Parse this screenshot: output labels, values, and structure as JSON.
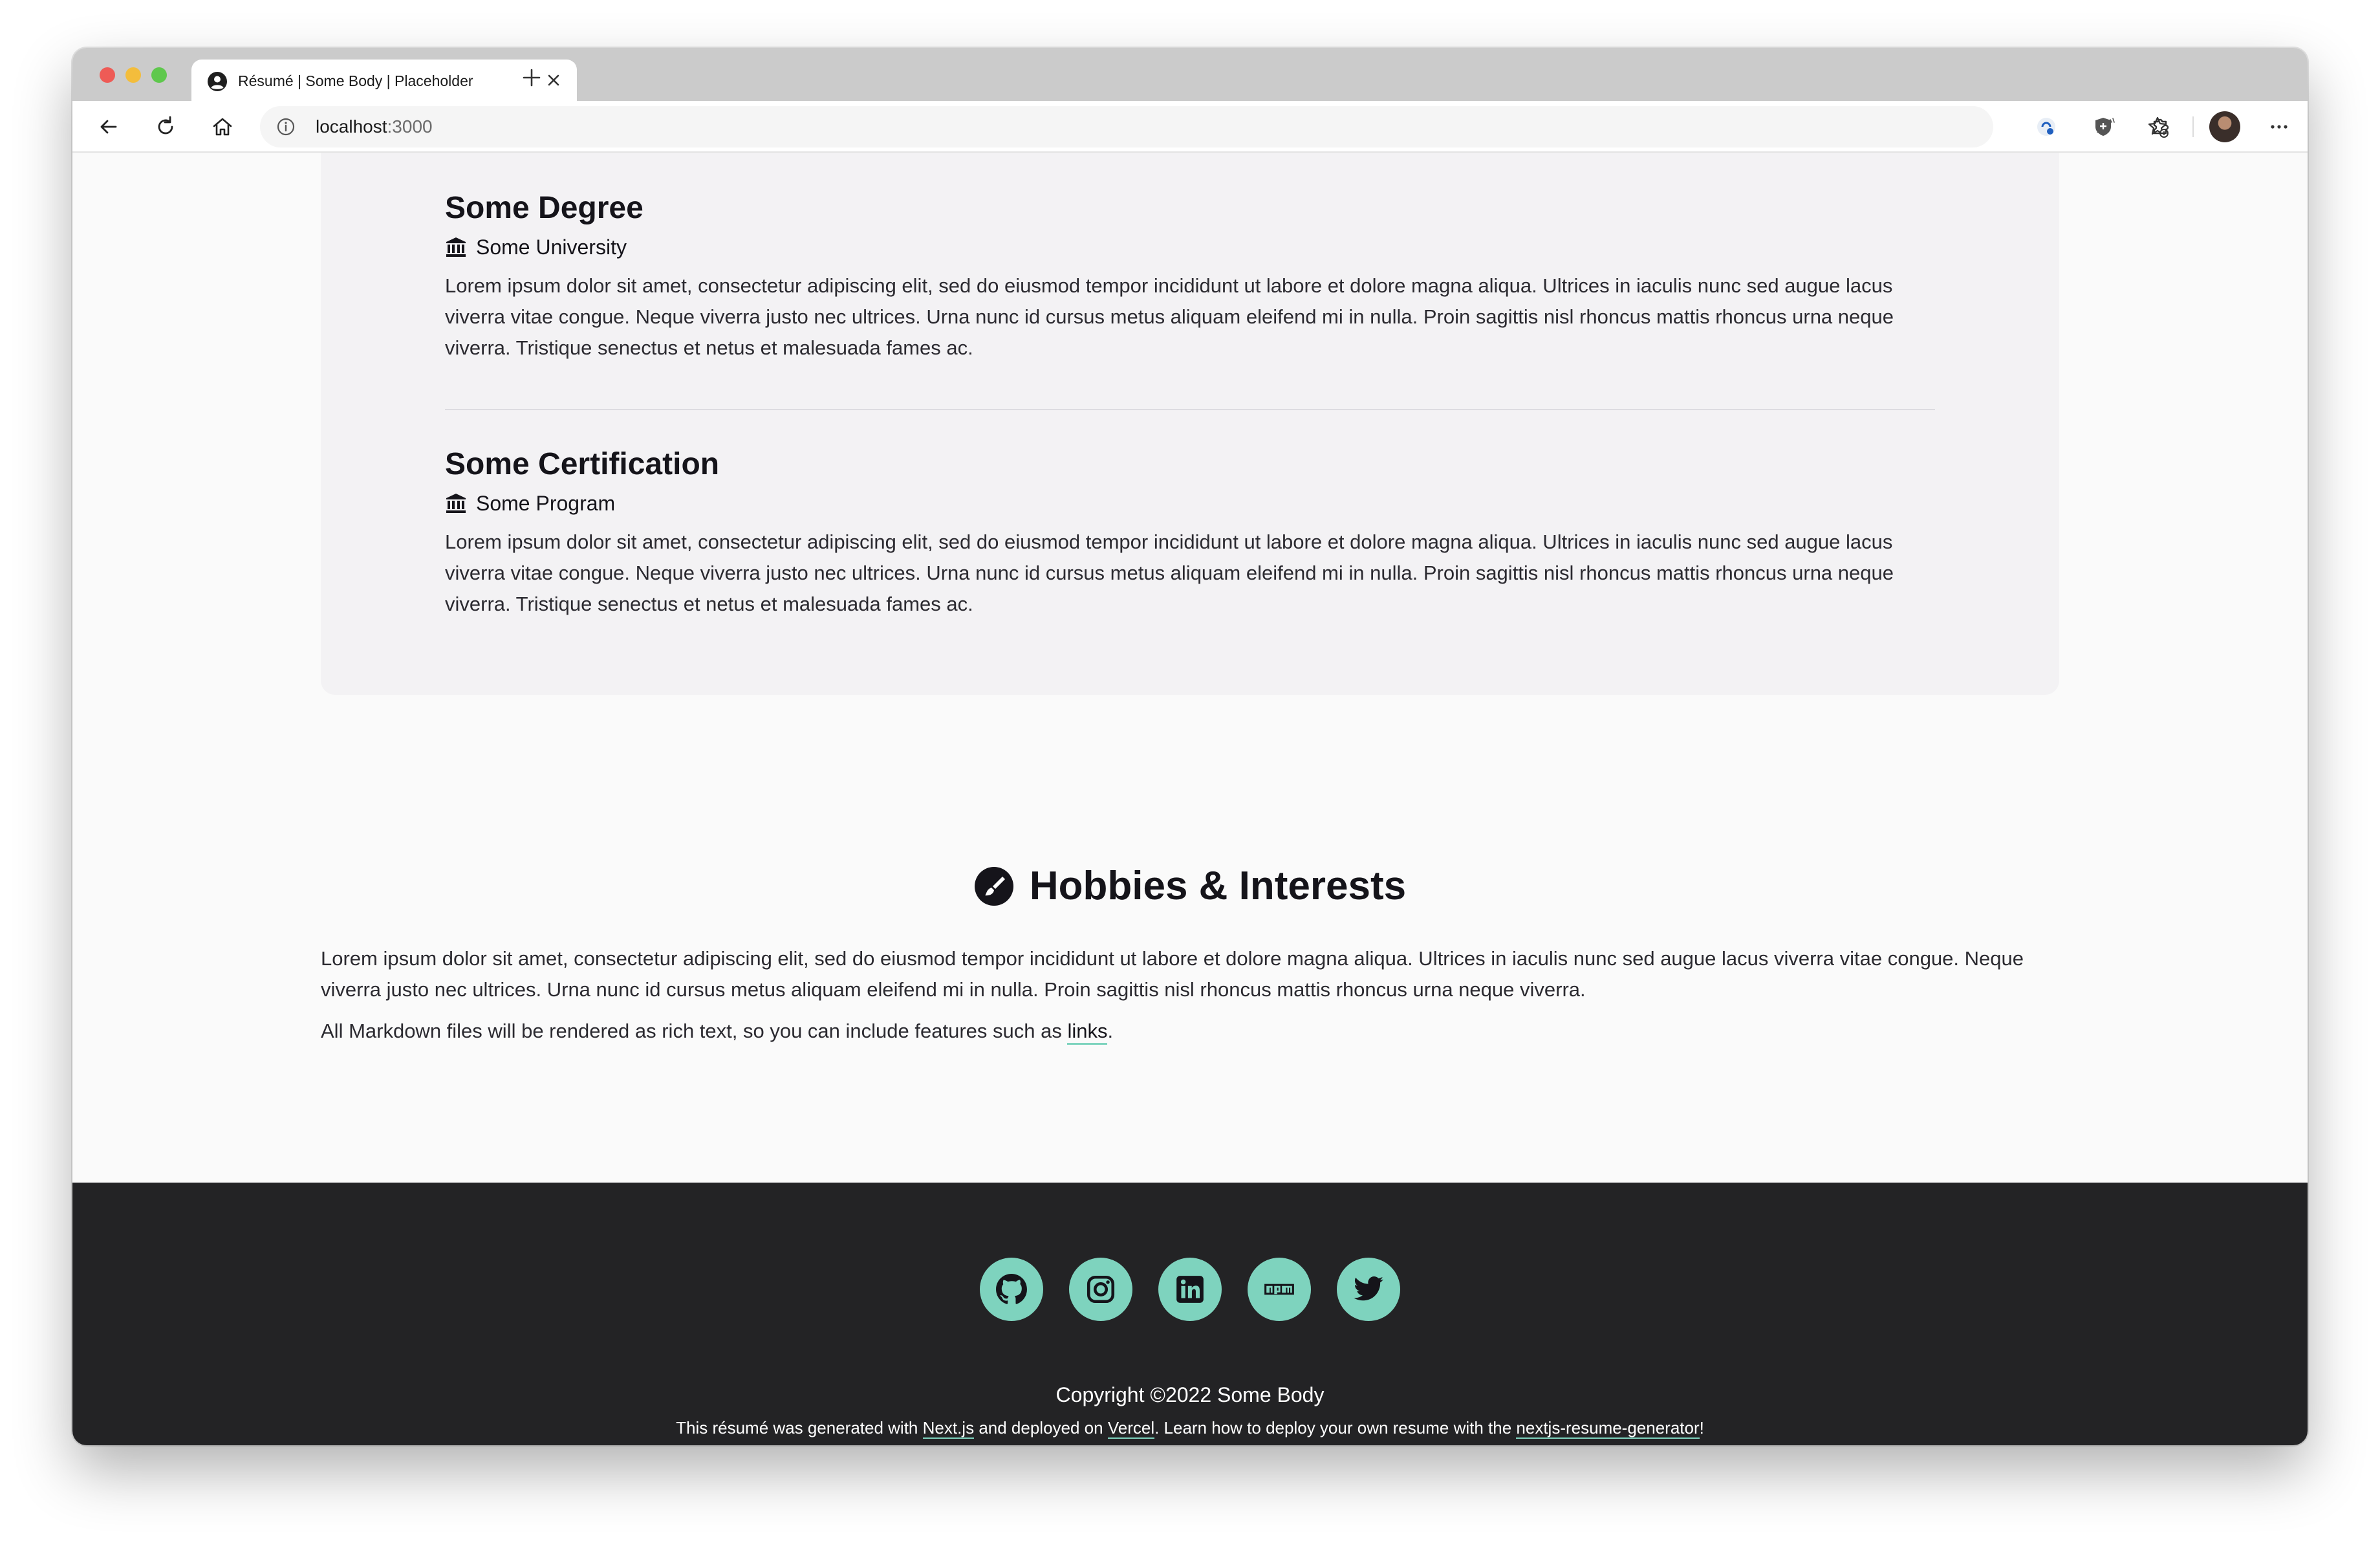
{
  "browser": {
    "tab": {
      "title": "Résumé | Some Body | Placeholder"
    },
    "address": {
      "host": "localhost",
      "port": ":3000"
    }
  },
  "education": [
    {
      "title": "Some Degree",
      "institution": "Some University",
      "description": "Lorem ipsum dolor sit amet, consectetur adipiscing elit, sed do eiusmod tempor incididunt ut labore et dolore magna aliqua. Ultrices in iaculis nunc sed augue lacus viverra vitae congue. Neque viverra justo nec ultrices. Urna nunc id cursus metus aliquam eleifend mi in nulla. Proin sagittis nisl rhoncus mattis rhoncus urna neque viverra. Tristique senectus et netus et malesuada fames ac."
    },
    {
      "title": "Some Certification",
      "institution": "Some Program",
      "description": "Lorem ipsum dolor sit amet, consectetur adipiscing elit, sed do eiusmod tempor incididunt ut labore et dolore magna aliqua. Ultrices in iaculis nunc sed augue lacus viverra vitae congue. Neque viverra justo nec ultrices. Urna nunc id cursus metus aliquam eleifend mi in nulla. Proin sagittis nisl rhoncus mattis rhoncus urna neque viverra. Tristique senectus et netus et malesuada fames ac."
    }
  ],
  "hobbies": {
    "title": "Hobbies & Interests",
    "paragraph": "Lorem ipsum dolor sit amet, consectetur adipiscing elit, sed do eiusmod tempor incididunt ut labore et dolore magna aliqua. Ultrices in iaculis nunc sed augue lacus viverra vitae congue. Neque viverra justo nec ultrices. Urna nunc id cursus metus aliquam eleifend mi in nulla. Proin sagittis nisl rhoncus mattis rhoncus urna neque viverra.",
    "markdown_prefix": "All Markdown files will be rendered as rich text, so you can include features such as ",
    "link_label": "links",
    "markdown_suffix": "."
  },
  "footer": {
    "socials": [
      "github-icon",
      "instagram-icon",
      "linkedin-icon",
      "npm-icon",
      "twitter-icon"
    ],
    "copyright": "Copyright ©2022 Some Body",
    "credit": {
      "part1": "This résumé was generated with ",
      "nextjs": "Next.js",
      "part2": " and deployed on ",
      "vercel": "Vercel",
      "part3": ". Learn how to deploy your own resume with the ",
      "generator": "nextjs-resume-generator",
      "part4": "!"
    }
  },
  "colors": {
    "accent": "#7ed3be",
    "footer_bg": "#232325",
    "card_bg": "#f3f2f4",
    "text": "#15141a"
  }
}
